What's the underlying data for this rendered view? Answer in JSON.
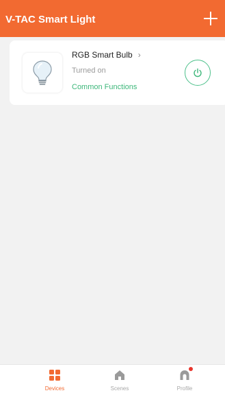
{
  "header": {
    "title": "V-TAC Smart Light",
    "add_icon": "plus-icon"
  },
  "device": {
    "name": "RGB Smart Bulb",
    "chevron": "›",
    "status": "Turned on",
    "common_functions": "Common Functions",
    "thumb_icon": "light-bulb-icon",
    "power_icon": "power-icon"
  },
  "nav": {
    "items": [
      {
        "label": "Devices",
        "icon": "devices-grid-icon",
        "active": true
      },
      {
        "label": "Scenes",
        "icon": "home-icon",
        "active": false
      },
      {
        "label": "Profile",
        "icon": "profile-icon",
        "active": false
      }
    ]
  },
  "colors": {
    "brand": "#f26a31",
    "accent_green": "#3db77a",
    "background": "#f2f2f2",
    "badge": "#e8352c"
  }
}
